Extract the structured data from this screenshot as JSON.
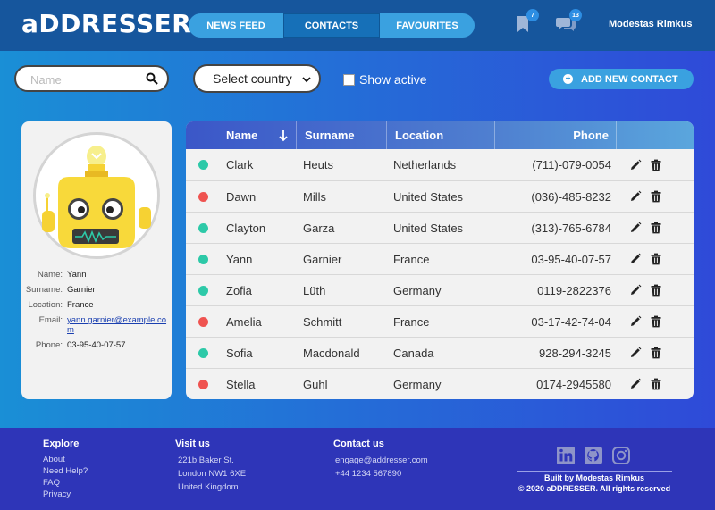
{
  "app": {
    "logo": "aDDRESSER"
  },
  "nav": {
    "tabs": [
      {
        "label": "NEWS FEED"
      },
      {
        "label": "CONTACTS"
      },
      {
        "label": "FAVOURITES"
      }
    ]
  },
  "header": {
    "bookmark_badge": "7",
    "chat_badge": "13",
    "user_name": "Modestas Rimkus"
  },
  "toolbar": {
    "search_placeholder": "Name",
    "country_selected": "Select country",
    "show_active_label": "Show active",
    "add_button_label": "ADD NEW CONTACT"
  },
  "profile": {
    "fields": [
      {
        "label": "Name:",
        "value": "Yann"
      },
      {
        "label": "Surname:",
        "value": "Garnier"
      },
      {
        "label": "Location:",
        "value": "France"
      },
      {
        "label": "Email:",
        "value": "yann.garnier@example.com"
      },
      {
        "label": "Phone:",
        "value": "03-95-40-07-57"
      }
    ]
  },
  "table": {
    "headers": {
      "name": "Name",
      "surname": "Surname",
      "location": "Location",
      "phone": "Phone"
    },
    "rows": [
      {
        "active": true,
        "name": "Clark",
        "surname": "Heuts",
        "location": "Netherlands",
        "phone": "(711)-079-0054"
      },
      {
        "active": false,
        "name": "Dawn",
        "surname": "Mills",
        "location": "United States",
        "phone": "(036)-485-8232"
      },
      {
        "active": true,
        "name": "Clayton",
        "surname": "Garza",
        "location": "United States",
        "phone": "(313)-765-6784"
      },
      {
        "active": true,
        "name": "Yann",
        "surname": "Garnier",
        "location": "France",
        "phone": "03-95-40-07-57"
      },
      {
        "active": true,
        "name": "Zofia",
        "surname": "Lüth",
        "location": "Germany",
        "phone": "0119-2822376"
      },
      {
        "active": false,
        "name": "Amelia",
        "surname": "Schmitt",
        "location": "France",
        "phone": "03-17-42-74-04"
      },
      {
        "active": true,
        "name": "Sofia",
        "surname": "Macdonald",
        "location": "Canada",
        "phone": "928-294-3245"
      },
      {
        "active": false,
        "name": "Stella",
        "surname": "Guhl",
        "location": "Germany",
        "phone": "0174-2945580"
      }
    ]
  },
  "footer": {
    "explore": {
      "title": "Explore",
      "links": [
        "About",
        "Need Help?",
        "FAQ",
        "Privacy"
      ]
    },
    "visit": {
      "title": "Visit us",
      "lines": [
        "221b Baker St.",
        "London NW1 6XE",
        "United Kingdom"
      ]
    },
    "contact": {
      "title": "Contact us",
      "lines": [
        "engage@addresser.com",
        "+44 1234 567890"
      ]
    },
    "credits": [
      "Built by Modestas Rimkus",
      "© 2020 aDDRESSER. All rights reserved"
    ]
  },
  "colors": {
    "active_dot": "#2dc9a8",
    "inactive_dot": "#ef5350",
    "header_bg": "#16569d",
    "footer_bg": "#2e35b8",
    "accent": "#3aa1e0"
  }
}
